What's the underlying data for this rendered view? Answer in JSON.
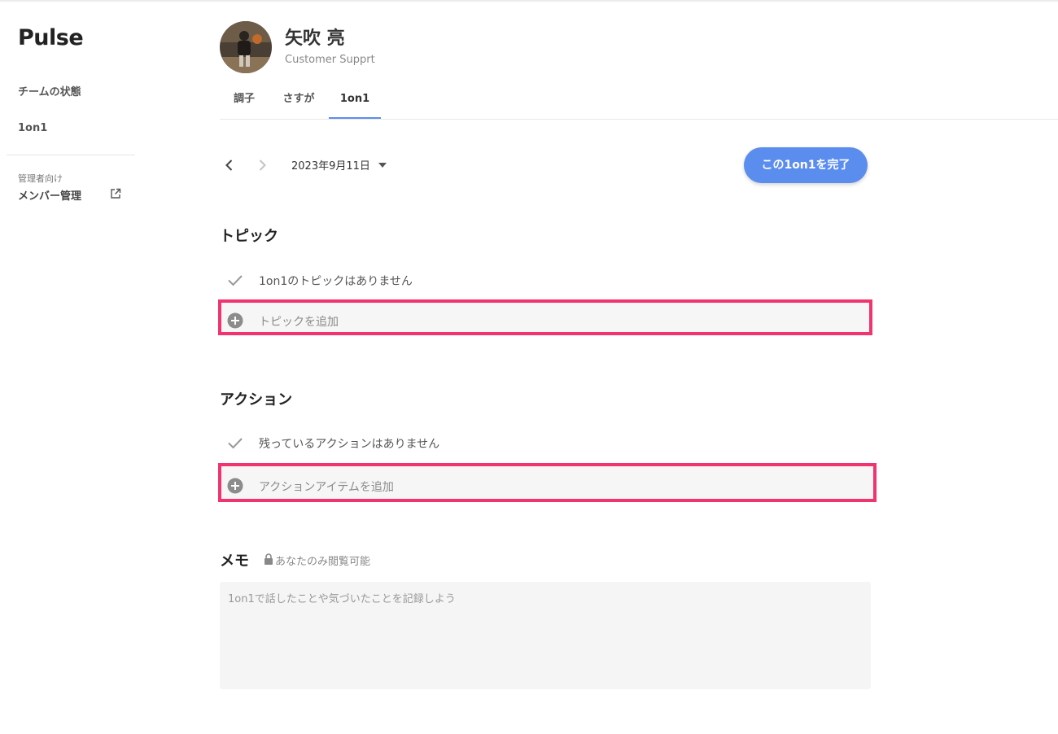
{
  "app": {
    "logo": "Pulse"
  },
  "sidebar": {
    "items": [
      {
        "label": "チームの状態"
      },
      {
        "label": "1on1"
      }
    ],
    "admin_caption": "管理者向け",
    "admin_link": "メンバー管理"
  },
  "member": {
    "name": "矢吹 亮",
    "role": "Customer Supprt"
  },
  "tabs": [
    {
      "label": "調子",
      "active": false
    },
    {
      "label": "さすが",
      "active": false
    },
    {
      "label": "1on1",
      "active": true
    }
  ],
  "session": {
    "date": "2023年9月11日",
    "complete_label": "この1on1を完了"
  },
  "topics": {
    "title": "トピック",
    "empty_text": "1on1のトピックはありません",
    "add_label": "トピックを追加"
  },
  "actions": {
    "title": "アクション",
    "empty_text": "残っているアクションはありません",
    "add_label": "アクションアイテムを追加"
  },
  "memo": {
    "title": "メモ",
    "visibility_note": "あなたのみ閲覧可能",
    "placeholder": "1on1で話したことや気づいたことを記録しよう",
    "value": ""
  },
  "colors": {
    "accent": "#5b8def",
    "highlight": "#f0346e"
  }
}
